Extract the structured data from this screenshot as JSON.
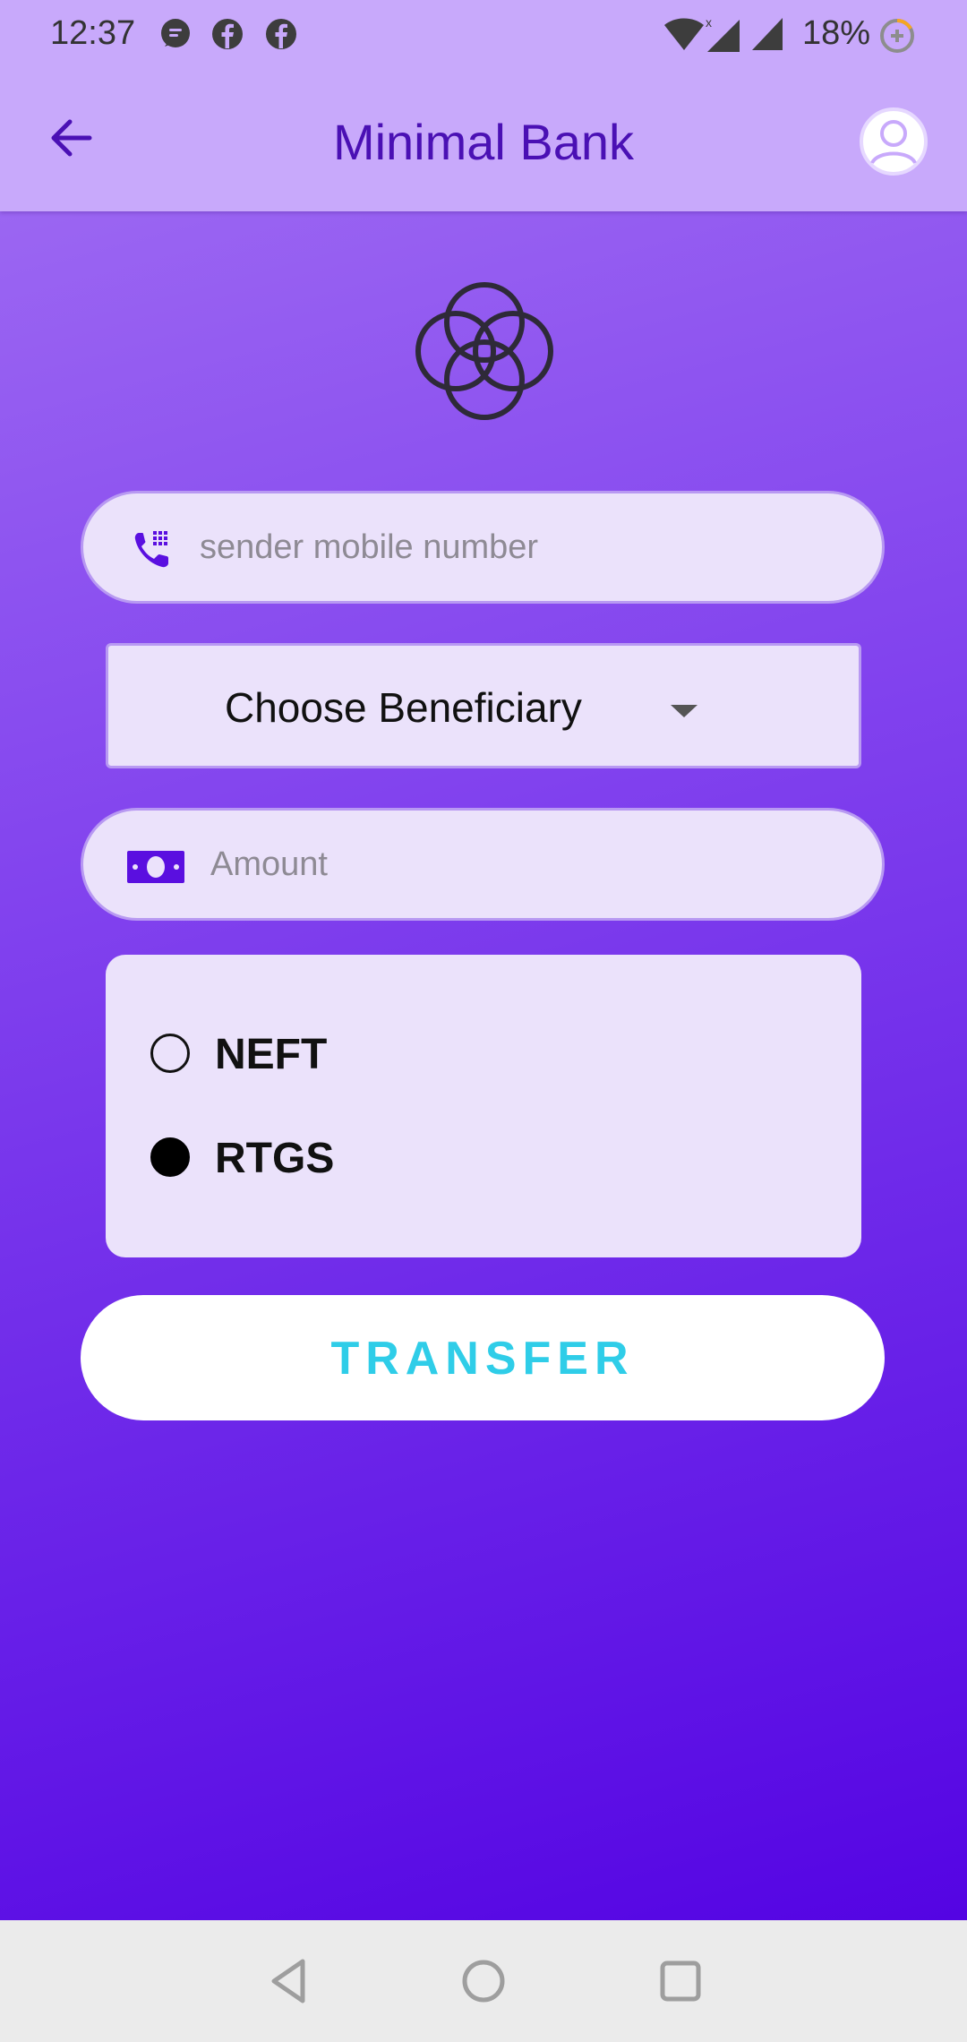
{
  "status_bar": {
    "time": "12:37",
    "notification_icons": [
      "messenger-icon",
      "facebook-icon",
      "facebook-icon"
    ],
    "battery": "18%"
  },
  "header": {
    "title": "Minimal Bank",
    "back_icon": "arrow-left-icon",
    "profile_icon": "account-circle-icon"
  },
  "form": {
    "mobile_placeholder": "sender mobile number",
    "beneficiary_label": "Choose Beneficiary",
    "amount_placeholder": "Amount",
    "transfer_modes": [
      {
        "label": "NEFT",
        "selected": false
      },
      {
        "label": "RTGS",
        "selected": true
      }
    ],
    "transfer_button": "TRANSFER"
  },
  "colors": {
    "appbar": "#c8a9fb",
    "title": "#4a10b4",
    "field_bg": "#ebe2fb",
    "button_text": "#2fcde8",
    "icon_accent": "#5a0fe0"
  }
}
